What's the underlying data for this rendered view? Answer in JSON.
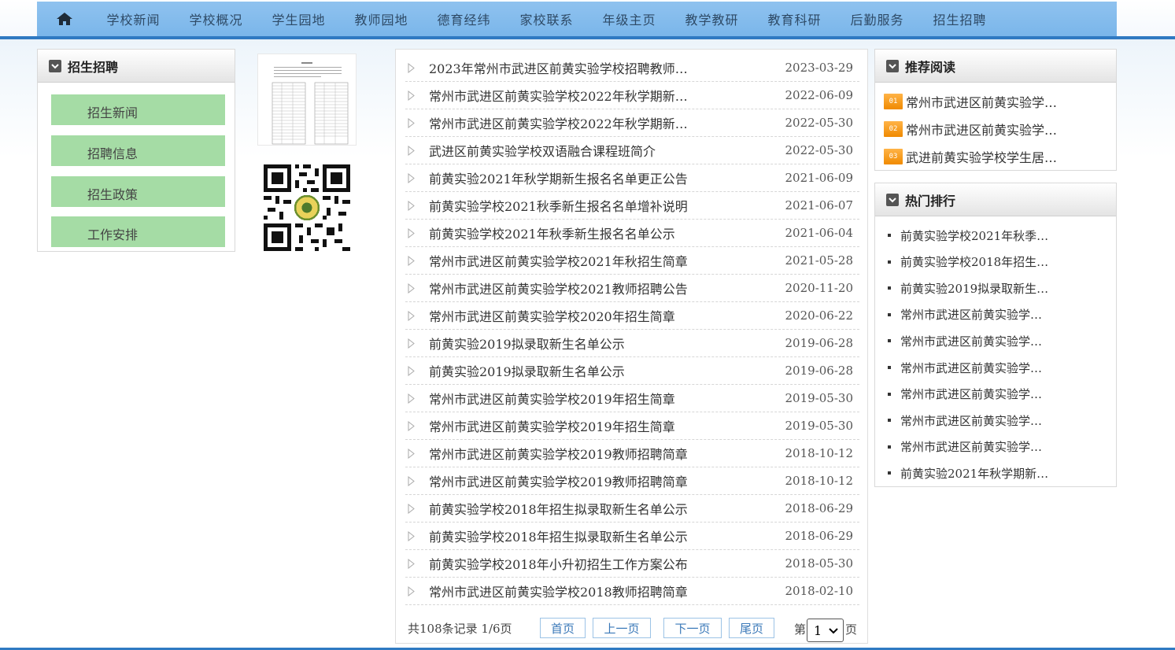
{
  "nav": {
    "home_icon": "home-icon",
    "items": [
      "学校新闻",
      "学校概况",
      "学生园地",
      "教师园地",
      "德育经纬",
      "家校联系",
      "年级主页",
      "教学教研",
      "教育科研",
      "后勤服务",
      "招生招聘"
    ]
  },
  "left": {
    "title": "招生招聘",
    "menu": [
      "招生新闻",
      "招聘信息",
      "招生政策",
      "工作安排"
    ]
  },
  "list": {
    "rows": [
      {
        "title": "2023年常州市武进区前黄实验学校招聘教师…",
        "date": "2023-03-29"
      },
      {
        "title": "常州市武进区前黄实验学校2022年秋学期新…",
        "date": "2022-06-09"
      },
      {
        "title": "常州市武进区前黄实验学校2022年秋学期新…",
        "date": "2022-05-30"
      },
      {
        "title": "武进区前黄实验学校双语融合课程班简介",
        "date": "2022-05-30"
      },
      {
        "title": "前黄实验2021年秋学期新生报名名单更正公告",
        "date": "2021-06-09"
      },
      {
        "title": "前黄实验学校2021秋季新生报名名单增补说明",
        "date": "2021-06-07"
      },
      {
        "title": "前黄实验学校2021年秋季新生报名名单公示",
        "date": "2021-06-04"
      },
      {
        "title": "常州市武进区前黄实验学校2021年秋招生简章",
        "date": "2021-05-28"
      },
      {
        "title": "常州市武进区前黄实验学校2021教师招聘公告",
        "date": "2020-11-20"
      },
      {
        "title": "常州市武进区前黄实验学校2020年招生简章",
        "date": "2020-06-22"
      },
      {
        "title": "前黄实验2019拟录取新生名单公示",
        "date": "2019-06-28"
      },
      {
        "title": "前黄实验2019拟录取新生名单公示",
        "date": "2019-06-28"
      },
      {
        "title": "常州市武进区前黄实验学校2019年招生简章",
        "date": "2019-05-30"
      },
      {
        "title": "常州市武进区前黄实验学校2019年招生简章",
        "date": "2019-05-30"
      },
      {
        "title": "常州市武进区前黄实验学校2019教师招聘简章",
        "date": "2018-10-12"
      },
      {
        "title": "常州市武进区前黄实验学校2019教师招聘简章",
        "date": "2018-10-12"
      },
      {
        "title": "前黄实验学校2018年招生拟录取新生名单公示",
        "date": "2018-06-29"
      },
      {
        "title": "前黄实验学校2018年招生拟录取新生名单公示",
        "date": "2018-06-29"
      },
      {
        "title": "前黄实验学校2018年小升初招生工作方案公布",
        "date": "2018-05-30"
      },
      {
        "title": "常州市武进区前黄实验学校2018教师招聘简章",
        "date": "2018-02-10"
      }
    ]
  },
  "pager": {
    "summary": "共108条记录 1/6页",
    "first": "首页",
    "prev": "上一页",
    "next": "下一页",
    "last": "尾页",
    "page_prefix": "第",
    "page_value": "1",
    "page_suffix": "页"
  },
  "recommend": {
    "title": "推荐阅读",
    "items": [
      {
        "badge": "01",
        "text": "常州市武进区前黄实验学…"
      },
      {
        "badge": "02",
        "text": "常州市武进区前黄实验学…"
      },
      {
        "badge": "03",
        "text": "武进前黄实验学校学生居…"
      }
    ]
  },
  "hot": {
    "title": "热门排行",
    "items": [
      "前黄实验学校2021年秋季…",
      "前黄实验学校2018年招生…",
      "前黄实验2019拟录取新生…",
      "常州市武进区前黄实验学…",
      "常州市武进区前黄实验学…",
      "常州市武进区前黄实验学…",
      "常州市武进区前黄实验学…",
      "常州市武进区前黄实验学…",
      "常州市武进区前黄实验学…",
      "前黄实验2021年秋学期新…"
    ]
  }
}
